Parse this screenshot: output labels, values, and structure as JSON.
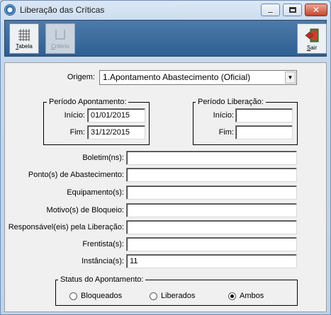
{
  "window": {
    "title": "Liberação das Críticas",
    "icon": "app-circle-icon",
    "controls": {
      "minimize": "minimize-icon",
      "maximize": "maximize-icon",
      "close": "✕"
    }
  },
  "toolbar": {
    "tabela_label": "Tabela",
    "criterio_label": "Critério",
    "sair_label": "Sair"
  },
  "form": {
    "origem_label": "Origem:",
    "origem_value": "1.Apontamento Abastecimento (Oficial)",
    "periodo_apontamento": {
      "title": "Período Apontamento:",
      "inicio_label": "Início:",
      "inicio_value": "01/01/2015",
      "fim_label": "Fim:",
      "fim_value": "31/12/2015"
    },
    "periodo_liberacao": {
      "title": "Período Liberação:",
      "inicio_label": "Início:",
      "inicio_value": "",
      "fim_label": "Fim:",
      "fim_value": ""
    },
    "boletim_label": "Boletim(ns):",
    "boletim_value": "",
    "ponto_label": "Ponto(s) de Abastecimento:",
    "ponto_value": "",
    "equipamento_label": "Equipamento(s):",
    "equipamento_value": "",
    "motivo_label": "Motivo(s) de Bloqueio:",
    "motivo_value": "",
    "responsavel_label": "Responsável(eis) pela Liberação:",
    "responsavel_value": "",
    "frentista_label": "Frentista(s):",
    "frentista_value": "",
    "instancia_label": "Instância(s):",
    "instancia_value": "11",
    "status": {
      "title": "Status do Apontamento:",
      "options": [
        "Bloqueados",
        "Liberados",
        "Ambos"
      ],
      "selected": "Ambos"
    }
  }
}
